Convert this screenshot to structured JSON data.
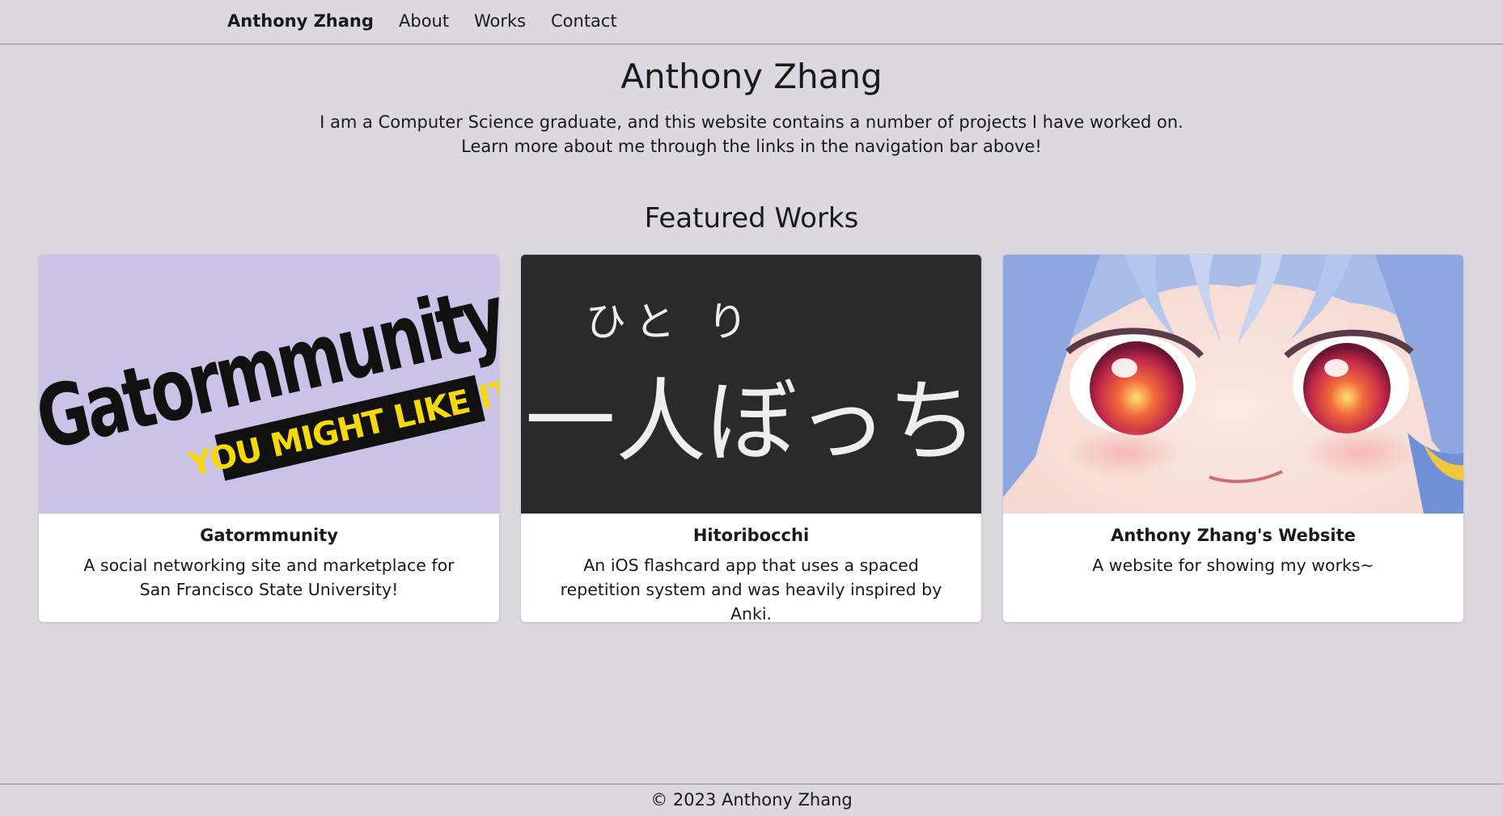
{
  "nav": {
    "brand": "Anthony Zhang",
    "links": [
      "About",
      "Works",
      "Contact"
    ]
  },
  "hero": {
    "title": "Anthony Zhang",
    "line1": "I am a Computer Science graduate, and this website contains a number of projects I have worked on.",
    "line2": "Learn more about me through the links in the navigation bar above!"
  },
  "featured": {
    "title": "Featured Works",
    "cards": [
      {
        "title": "Gatormmunity",
        "description": "A social networking site and marketplace for San Francisco State University!",
        "image_text": "Gatormmunity",
        "image_banner": "YOU MIGHT LIKE IT"
      },
      {
        "title": "Hitoribocchi",
        "description": "An iOS flashcard app that uses a spaced repetition system and was heavily inspired by Anki.",
        "image_ruby": "ひと り",
        "image_text": "一人ぼっち"
      },
      {
        "title": "Anthony Zhang's Website",
        "description": "A website for showing my works~"
      }
    ]
  },
  "footer": {
    "text": "© 2023 Anthony Zhang"
  },
  "colors": {
    "background": "#dcd8e2",
    "card1_bg": "#cbc3e7",
    "card2_bg": "#2a2a2a",
    "banner_yellow": "#f5d90a"
  }
}
